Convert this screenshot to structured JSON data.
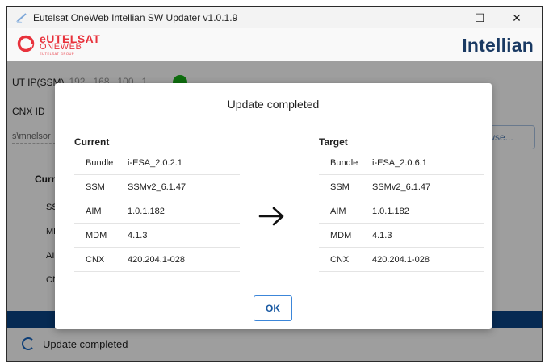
{
  "window": {
    "title": "Eutelsat OneWeb Intellian SW Updater v1.0.1.9",
    "controls": {
      "minimize": "—",
      "maximize": "☐",
      "close": "✕"
    }
  },
  "brand": {
    "left_line1": "eUTELSAT",
    "left_line2": "ONEWEB",
    "left_line3": "EUTELSAT GROUP",
    "right": "Intellian",
    "colors": {
      "eutelsat_red": "#e8323c",
      "intellian_navy": "#1a3a63"
    }
  },
  "form": {
    "ut_ip_label": "UT IP(SSM)",
    "ut_ip_value": "192 . 168 . 100 .  1",
    "connection_status_color": "#17b117",
    "cnx_id_label": "CNX ID",
    "path_value": "s\\mnelsor",
    "browse_label": "wse..."
  },
  "background_versions": {
    "heading": "Curre",
    "items": [
      "SSN",
      "MD",
      "AIN",
      "CN"
    ]
  },
  "progress": {
    "color": "#0a4487",
    "value": 1.0
  },
  "status": {
    "text": "Update completed",
    "spinner_color": "#1565c0"
  },
  "dialog": {
    "title": "Update completed",
    "current": {
      "heading": "Current",
      "rows": [
        {
          "key": "Bundle",
          "value": "i-ESA_2.0.2.1"
        },
        {
          "key": "SSM",
          "value": "SSMv2_6.1.47"
        },
        {
          "key": "AIM",
          "value": "1.0.1.182"
        },
        {
          "key": "MDM",
          "value": "4.1.3"
        },
        {
          "key": "CNX",
          "value": "420.204.1-028"
        }
      ]
    },
    "target": {
      "heading": "Target",
      "rows": [
        {
          "key": "Bundle",
          "value": "i-ESA_2.0.6.1"
        },
        {
          "key": "SSM",
          "value": "SSMv2_6.1.47"
        },
        {
          "key": "AIM",
          "value": "1.0.1.182"
        },
        {
          "key": "MDM",
          "value": "4.1.3"
        },
        {
          "key": "CNX",
          "value": "420.204.1-028"
        }
      ]
    },
    "arrow_icon": "arrow-right-icon",
    "ok_label": "OK"
  }
}
